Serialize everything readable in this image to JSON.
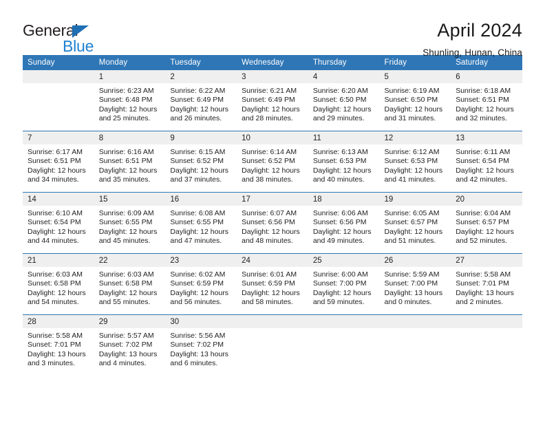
{
  "brand": {
    "name_part1": "General",
    "name_part2": "Blue",
    "logo_icon": "blue-triangle-icon",
    "accent_color": "#2f76b6",
    "blue_text_color": "#2080d0"
  },
  "header": {
    "title": "April 2024",
    "subtitle": "Shunling, Hunan, China"
  },
  "calendar": {
    "weekday_headers": [
      "Sunday",
      "Monday",
      "Tuesday",
      "Wednesday",
      "Thursday",
      "Friday",
      "Saturday"
    ],
    "labels": {
      "sunrise_prefix": "Sunrise:",
      "sunset_prefix": "Sunset:",
      "daylight_prefix": "Daylight:"
    },
    "weeks": [
      [
        {
          "day": "",
          "sunrise": "",
          "sunset": "",
          "daylight_line1": "",
          "daylight_line2": "",
          "empty": true
        },
        {
          "day": "1",
          "sunrise": "Sunrise: 6:23 AM",
          "sunset": "Sunset: 6:48 PM",
          "daylight_line1": "Daylight: 12 hours",
          "daylight_line2": "and 25 minutes.",
          "empty": false
        },
        {
          "day": "2",
          "sunrise": "Sunrise: 6:22 AM",
          "sunset": "Sunset: 6:49 PM",
          "daylight_line1": "Daylight: 12 hours",
          "daylight_line2": "and 26 minutes.",
          "empty": false
        },
        {
          "day": "3",
          "sunrise": "Sunrise: 6:21 AM",
          "sunset": "Sunset: 6:49 PM",
          "daylight_line1": "Daylight: 12 hours",
          "daylight_line2": "and 28 minutes.",
          "empty": false
        },
        {
          "day": "4",
          "sunrise": "Sunrise: 6:20 AM",
          "sunset": "Sunset: 6:50 PM",
          "daylight_line1": "Daylight: 12 hours",
          "daylight_line2": "and 29 minutes.",
          "empty": false
        },
        {
          "day": "5",
          "sunrise": "Sunrise: 6:19 AM",
          "sunset": "Sunset: 6:50 PM",
          "daylight_line1": "Daylight: 12 hours",
          "daylight_line2": "and 31 minutes.",
          "empty": false
        },
        {
          "day": "6",
          "sunrise": "Sunrise: 6:18 AM",
          "sunset": "Sunset: 6:51 PM",
          "daylight_line1": "Daylight: 12 hours",
          "daylight_line2": "and 32 minutes.",
          "empty": false
        }
      ],
      [
        {
          "day": "7",
          "sunrise": "Sunrise: 6:17 AM",
          "sunset": "Sunset: 6:51 PM",
          "daylight_line1": "Daylight: 12 hours",
          "daylight_line2": "and 34 minutes.",
          "empty": false
        },
        {
          "day": "8",
          "sunrise": "Sunrise: 6:16 AM",
          "sunset": "Sunset: 6:51 PM",
          "daylight_line1": "Daylight: 12 hours",
          "daylight_line2": "and 35 minutes.",
          "empty": false
        },
        {
          "day": "9",
          "sunrise": "Sunrise: 6:15 AM",
          "sunset": "Sunset: 6:52 PM",
          "daylight_line1": "Daylight: 12 hours",
          "daylight_line2": "and 37 minutes.",
          "empty": false
        },
        {
          "day": "10",
          "sunrise": "Sunrise: 6:14 AM",
          "sunset": "Sunset: 6:52 PM",
          "daylight_line1": "Daylight: 12 hours",
          "daylight_line2": "and 38 minutes.",
          "empty": false
        },
        {
          "day": "11",
          "sunrise": "Sunrise: 6:13 AM",
          "sunset": "Sunset: 6:53 PM",
          "daylight_line1": "Daylight: 12 hours",
          "daylight_line2": "and 40 minutes.",
          "empty": false
        },
        {
          "day": "12",
          "sunrise": "Sunrise: 6:12 AM",
          "sunset": "Sunset: 6:53 PM",
          "daylight_line1": "Daylight: 12 hours",
          "daylight_line2": "and 41 minutes.",
          "empty": false
        },
        {
          "day": "13",
          "sunrise": "Sunrise: 6:11 AM",
          "sunset": "Sunset: 6:54 PM",
          "daylight_line1": "Daylight: 12 hours",
          "daylight_line2": "and 42 minutes.",
          "empty": false
        }
      ],
      [
        {
          "day": "14",
          "sunrise": "Sunrise: 6:10 AM",
          "sunset": "Sunset: 6:54 PM",
          "daylight_line1": "Daylight: 12 hours",
          "daylight_line2": "and 44 minutes.",
          "empty": false
        },
        {
          "day": "15",
          "sunrise": "Sunrise: 6:09 AM",
          "sunset": "Sunset: 6:55 PM",
          "daylight_line1": "Daylight: 12 hours",
          "daylight_line2": "and 45 minutes.",
          "empty": false
        },
        {
          "day": "16",
          "sunrise": "Sunrise: 6:08 AM",
          "sunset": "Sunset: 6:55 PM",
          "daylight_line1": "Daylight: 12 hours",
          "daylight_line2": "and 47 minutes.",
          "empty": false
        },
        {
          "day": "17",
          "sunrise": "Sunrise: 6:07 AM",
          "sunset": "Sunset: 6:56 PM",
          "daylight_line1": "Daylight: 12 hours",
          "daylight_line2": "and 48 minutes.",
          "empty": false
        },
        {
          "day": "18",
          "sunrise": "Sunrise: 6:06 AM",
          "sunset": "Sunset: 6:56 PM",
          "daylight_line1": "Daylight: 12 hours",
          "daylight_line2": "and 49 minutes.",
          "empty": false
        },
        {
          "day": "19",
          "sunrise": "Sunrise: 6:05 AM",
          "sunset": "Sunset: 6:57 PM",
          "daylight_line1": "Daylight: 12 hours",
          "daylight_line2": "and 51 minutes.",
          "empty": false
        },
        {
          "day": "20",
          "sunrise": "Sunrise: 6:04 AM",
          "sunset": "Sunset: 6:57 PM",
          "daylight_line1": "Daylight: 12 hours",
          "daylight_line2": "and 52 minutes.",
          "empty": false
        }
      ],
      [
        {
          "day": "21",
          "sunrise": "Sunrise: 6:03 AM",
          "sunset": "Sunset: 6:58 PM",
          "daylight_line1": "Daylight: 12 hours",
          "daylight_line2": "and 54 minutes.",
          "empty": false
        },
        {
          "day": "22",
          "sunrise": "Sunrise: 6:03 AM",
          "sunset": "Sunset: 6:58 PM",
          "daylight_line1": "Daylight: 12 hours",
          "daylight_line2": "and 55 minutes.",
          "empty": false
        },
        {
          "day": "23",
          "sunrise": "Sunrise: 6:02 AM",
          "sunset": "Sunset: 6:59 PM",
          "daylight_line1": "Daylight: 12 hours",
          "daylight_line2": "and 56 minutes.",
          "empty": false
        },
        {
          "day": "24",
          "sunrise": "Sunrise: 6:01 AM",
          "sunset": "Sunset: 6:59 PM",
          "daylight_line1": "Daylight: 12 hours",
          "daylight_line2": "and 58 minutes.",
          "empty": false
        },
        {
          "day": "25",
          "sunrise": "Sunrise: 6:00 AM",
          "sunset": "Sunset: 7:00 PM",
          "daylight_line1": "Daylight: 12 hours",
          "daylight_line2": "and 59 minutes.",
          "empty": false
        },
        {
          "day": "26",
          "sunrise": "Sunrise: 5:59 AM",
          "sunset": "Sunset: 7:00 PM",
          "daylight_line1": "Daylight: 13 hours",
          "daylight_line2": "and 0 minutes.",
          "empty": false
        },
        {
          "day": "27",
          "sunrise": "Sunrise: 5:58 AM",
          "sunset": "Sunset: 7:01 PM",
          "daylight_line1": "Daylight: 13 hours",
          "daylight_line2": "and 2 minutes.",
          "empty": false
        }
      ],
      [
        {
          "day": "28",
          "sunrise": "Sunrise: 5:58 AM",
          "sunset": "Sunset: 7:01 PM",
          "daylight_line1": "Daylight: 13 hours",
          "daylight_line2": "and 3 minutes.",
          "empty": false
        },
        {
          "day": "29",
          "sunrise": "Sunrise: 5:57 AM",
          "sunset": "Sunset: 7:02 PM",
          "daylight_line1": "Daylight: 13 hours",
          "daylight_line2": "and 4 minutes.",
          "empty": false
        },
        {
          "day": "30",
          "sunrise": "Sunrise: 5:56 AM",
          "sunset": "Sunset: 7:02 PM",
          "daylight_line1": "Daylight: 13 hours",
          "daylight_line2": "and 6 minutes.",
          "empty": false
        },
        {
          "day": "",
          "sunrise": "",
          "sunset": "",
          "daylight_line1": "",
          "daylight_line2": "",
          "empty": true
        },
        {
          "day": "",
          "sunrise": "",
          "sunset": "",
          "daylight_line1": "",
          "daylight_line2": "",
          "empty": true
        },
        {
          "day": "",
          "sunrise": "",
          "sunset": "",
          "daylight_line1": "",
          "daylight_line2": "",
          "empty": true
        },
        {
          "day": "",
          "sunrise": "",
          "sunset": "",
          "daylight_line1": "",
          "daylight_line2": "",
          "empty": true
        }
      ]
    ]
  }
}
